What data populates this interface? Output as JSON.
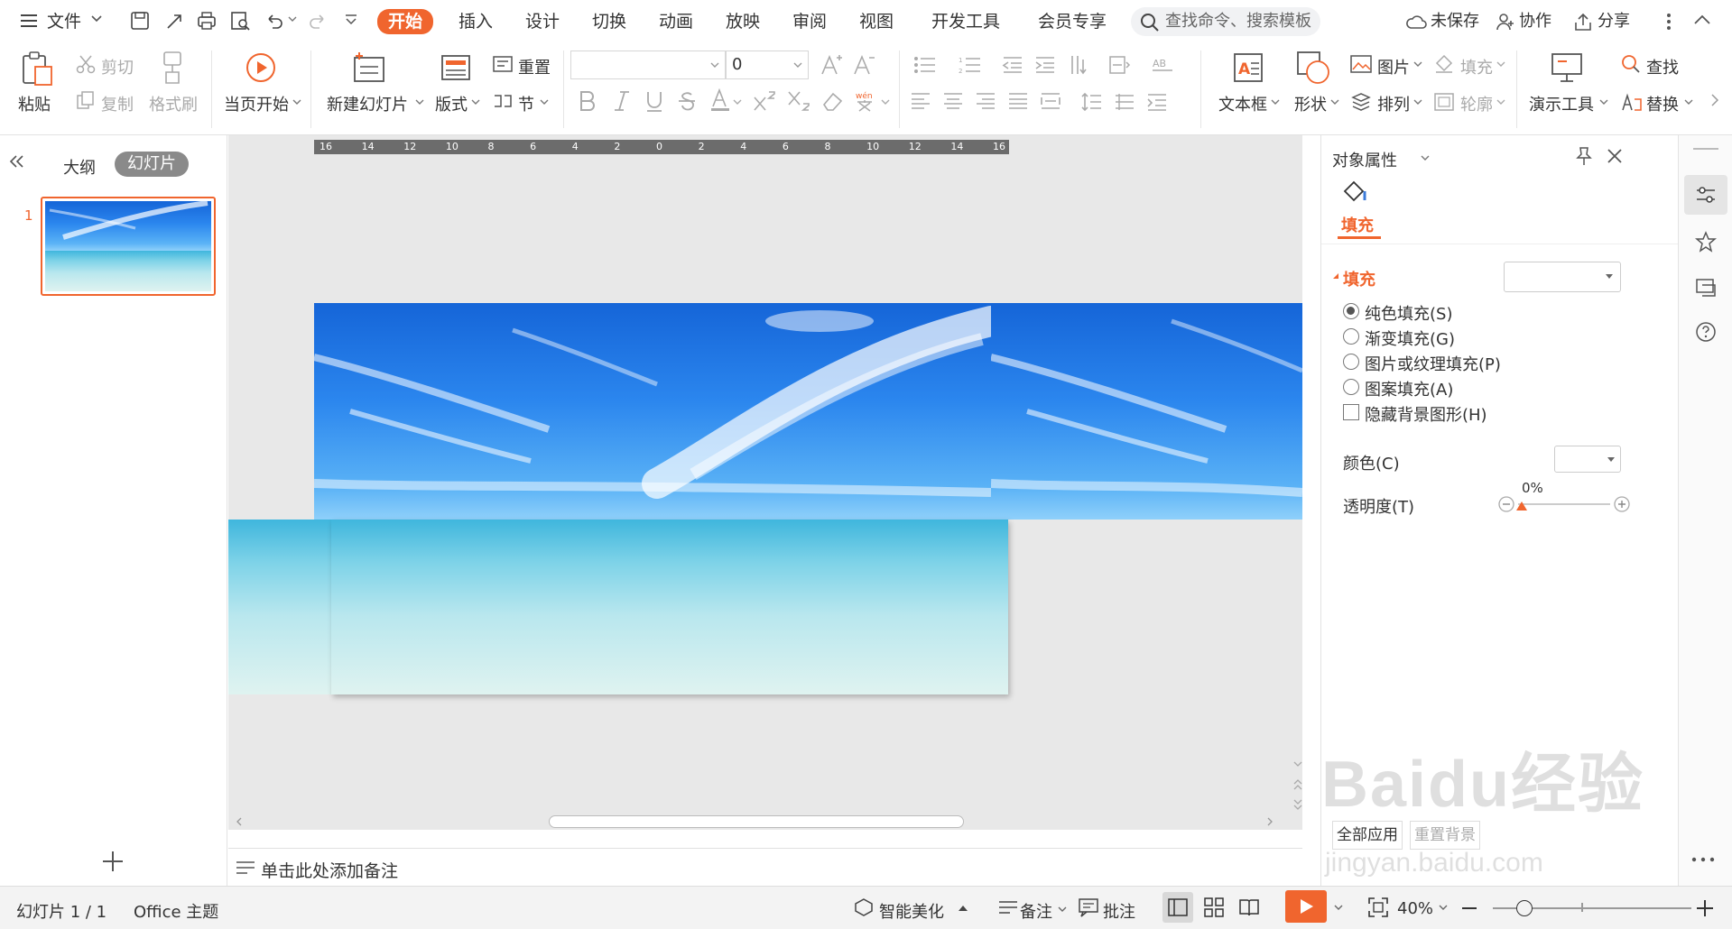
{
  "menu": {
    "file": "文件",
    "tabs": [
      "开始",
      "插入",
      "设计",
      "切换",
      "动画",
      "放映",
      "审阅",
      "视图",
      "开发工具",
      "会员专享"
    ],
    "search_placeholder": "查找命令、搜索模板",
    "unsaved": "未保存",
    "collab": "协作",
    "share": "分享"
  },
  "ribbon": {
    "paste": "粘贴",
    "cut": "剪切",
    "copy": "复制",
    "format_painter": "格式刷",
    "from_current": "当页开始",
    "new_slide": "新建幻灯片",
    "layout": "版式",
    "reset": "重置",
    "section": "节",
    "font_size": "0",
    "textbox": "文本框",
    "shape": "形状",
    "picture": "图片",
    "arrange": "排列",
    "fill": "填充",
    "outline": "轮廓",
    "presenter_tools": "演示工具",
    "find": "查找",
    "replace": "替换"
  },
  "left": {
    "tab_outline": "大纲",
    "tab_slides": "幻灯片",
    "slide_number": "1"
  },
  "ruler": [
    "16",
    "14",
    "12",
    "10",
    "8",
    "6",
    "4",
    "2",
    "0",
    "2",
    "4",
    "6",
    "8",
    "10",
    "12",
    "14",
    "16"
  ],
  "notes_placeholder": "单击此处添加备注",
  "props": {
    "title": "对象属性",
    "tab_fill": "填充",
    "section_fill": "填充",
    "opt_solid": "纯色填充(S)",
    "opt_gradient": "渐变填充(G)",
    "opt_picture": "图片或纹理填充(P)",
    "opt_pattern": "图案填充(A)",
    "opt_hide_bg": "隐藏背景图形(H)",
    "color_label": "颜色(C)",
    "transparency_label": "透明度(T)",
    "transparency_value": "0%",
    "apply_all": "全部应用",
    "reset_bg": "重置背景"
  },
  "status": {
    "slide_info": "幻灯片 1 / 1",
    "theme": "Office 主题",
    "beautify": "智能美化",
    "notes": "备注",
    "comments": "批注",
    "zoom": "40%"
  },
  "watermark": {
    "brand": "Baidu经验",
    "url": "jingyan.baidu.com"
  },
  "colors": {
    "accent": "#f0652e",
    "play": "#f0652e"
  }
}
